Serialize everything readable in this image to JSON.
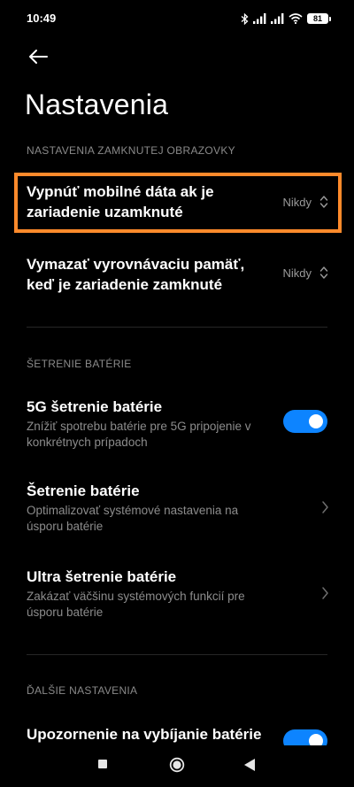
{
  "status_bar": {
    "time": "10:49",
    "battery_level": "81",
    "icons": [
      "bluetooth-icon",
      "signal-icon",
      "signal-icon-2",
      "wifi-icon",
      "battery-icon"
    ]
  },
  "header": {
    "back_icon": "arrow-left-icon",
    "title": "Nastavenia"
  },
  "sections": {
    "lock_screen": {
      "header": "NASTAVENIA ZAMKNUTEJ OBRAZOVKY",
      "items": [
        {
          "title": "Vypnúť mobilné dáta ak je\nzariadenie uzamknuté",
          "value": "Nikdy",
          "highlighted": true,
          "highlight_color": "#ff8a2b"
        },
        {
          "title": "Vymazať vyrovnávaciu pamäť,\nkeď je zariadenie zamknuté",
          "value": "Nikdy"
        }
      ]
    },
    "battery_saving": {
      "header": "ŠETRENIE BATÉRIE",
      "items": [
        {
          "title": "5G šetrenie batérie",
          "subtitle": "Znížiť spotrebu batérie pre 5G pripojenie v\nkonkrétnych prípadoch",
          "toggle_on": true
        },
        {
          "title": "Šetrenie batérie",
          "subtitle": "Optimalizovať systémové nastavenia na\núsporu batérie"
        },
        {
          "title": "Ultra šetrenie batérie",
          "subtitle": "Zakázať väčšinu systémových funkcií pre\núsporu batérie"
        }
      ]
    },
    "more": {
      "header": "ĎALŠIE NASTAVENIA",
      "items": [
        {
          "title": "Upozornenie na vybíjanie batérie",
          "toggle_on": true
        }
      ]
    }
  },
  "nav_bar": {
    "icons": [
      "recents-square-icon",
      "home-circle-icon",
      "back-triangle-icon"
    ]
  },
  "colors": {
    "background": "#000000",
    "accent": "#0d84ff",
    "highlight": "#ff8a2b"
  }
}
